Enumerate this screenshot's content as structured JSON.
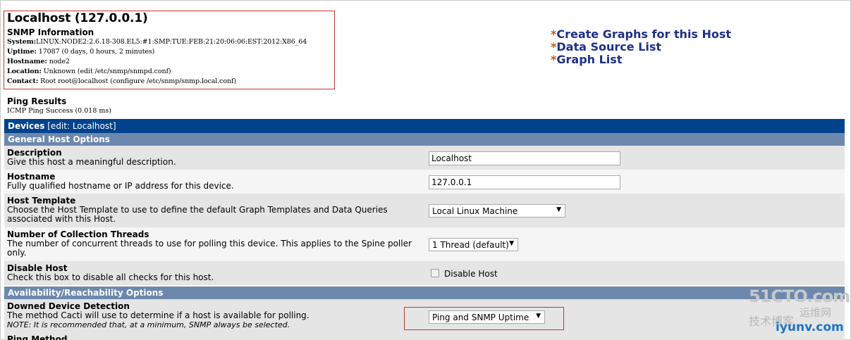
{
  "host": {
    "title": "Localhost (127.0.0.1)",
    "snmp_heading": "SNMP Information",
    "snmp_lines": [
      {
        "label": "System:",
        "value": "LINUX:NODE2:2.6.18-308.EL5:#1:SMP:TUE:FEB:21:20:06:06:EST:2012:X86_64"
      },
      {
        "label": "Uptime:",
        "value": " 17087 (0 days, 0 hours, 2 minutes)"
      },
      {
        "label": "Hostname:",
        "value": " node2"
      },
      {
        "label": "Location:",
        "value": " Unknown (edit /etc/snmp/snmpd.conf)"
      },
      {
        "label": "Contact:",
        "value": " Root root@localhost (configure /etc/snmp/snmp.local.conf)"
      }
    ]
  },
  "links": [
    {
      "star": "*",
      "label": "Create Graphs for this Host"
    },
    {
      "star": "*",
      "label": "Data Source List"
    },
    {
      "star": "*",
      "label": "Graph List"
    }
  ],
  "ping": {
    "title": "Ping Results",
    "value": "ICMP Ping Success (0.018 ms)"
  },
  "devices_bar": {
    "label": "Devices",
    "edit": " [edit: Localhost]"
  },
  "sections": {
    "general": "General Host Options",
    "availability": "Availability/Reachability Options"
  },
  "fields": {
    "description": {
      "title": "Description",
      "desc": "Give this host a meaningful description.",
      "value": "Localhost"
    },
    "hostname": {
      "title": "Hostname",
      "desc": "Fully qualified hostname or IP address for this device.",
      "value": "127.0.0.1"
    },
    "host_template": {
      "title": "Host Template",
      "desc": "Choose the Host Template to use to define the default Graph Templates and Data Queries associated with this Host.",
      "value": "Local Linux Machine"
    },
    "threads": {
      "title": "Number of Collection Threads",
      "desc": "The number of concurrent threads to use for polling this device. This applies to the Spine poller only.",
      "value": "1 Thread (default)"
    },
    "disable_host": {
      "title": "Disable Host",
      "desc": "Check this box to disable all checks for this host.",
      "checkbox_label": "Disable Host",
      "checked": false
    },
    "downed_detection": {
      "title": "Downed Device Detection",
      "desc": "The method Cacti will use to determine if a host is available for polling.",
      "note": "NOTE: It is recommended that, at a minimum, SNMP always be selected.",
      "value": "Ping and SNMP Uptime"
    },
    "ping_method": {
      "title": "Ping Method"
    }
  },
  "watermark": {
    "line1": "51CTO.com",
    "line2": "运维网",
    "line3": "技术博客",
    "line4": "iyunv.com"
  },
  "colors": {
    "devices_bar": "#00438c",
    "section_header": "#6d88ad",
    "link_text": "#1d2f8a",
    "link_star": "#c85a1a",
    "highlight_border": "#c0392b"
  }
}
